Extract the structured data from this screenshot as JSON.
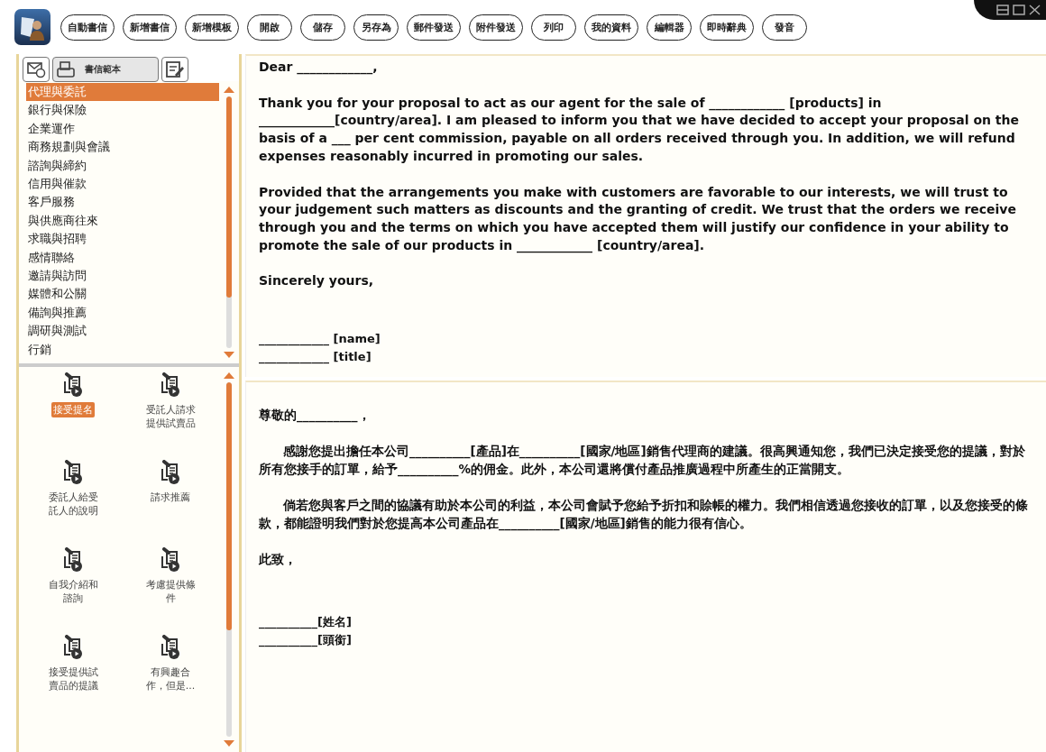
{
  "toolbar": {
    "buttons": [
      "自動書信",
      "新增書信",
      "新增模板",
      "開啟",
      "儲存",
      "另存為",
      "郵件發送",
      "附件發送",
      "列印",
      "我的資料",
      "編輯器",
      "即時辭典",
      "發音"
    ]
  },
  "side_tabs": [
    {
      "kind": "icon",
      "selected": false
    },
    {
      "kind": "labeled",
      "label": "書信範本",
      "selected": true
    },
    {
      "kind": "icon",
      "selected": false
    }
  ],
  "categories": [
    {
      "label": "代理與委託",
      "selected": true
    },
    {
      "label": "銀行與保險",
      "selected": false
    },
    {
      "label": "企業運作",
      "selected": false
    },
    {
      "label": "商務規劃與會議",
      "selected": false
    },
    {
      "label": "諮詢與締約",
      "selected": false
    },
    {
      "label": "信用與催款",
      "selected": false
    },
    {
      "label": "客戶服務",
      "selected": false
    },
    {
      "label": "與供應商往來",
      "selected": false
    },
    {
      "label": "求職與招聘",
      "selected": false
    },
    {
      "label": "感情聯絡",
      "selected": false
    },
    {
      "label": "邀請與訪問",
      "selected": false
    },
    {
      "label": "媒體和公關",
      "selected": false
    },
    {
      "label": "備詢與推薦",
      "selected": false
    },
    {
      "label": "調研與測試",
      "selected": false
    },
    {
      "label": "行銷",
      "selected": false
    }
  ],
  "templates": [
    {
      "label": "接受提名",
      "selected": true
    },
    {
      "label": "受託人請求提供試賣品",
      "selected": false
    },
    {
      "label": "委託人給受託人的說明",
      "selected": false
    },
    {
      "label": "請求推薦",
      "selected": false
    },
    {
      "label": "自我介紹和諮詢",
      "selected": false
    },
    {
      "label": "考慮提供條件",
      "selected": false
    },
    {
      "label": "接受提供試賣品的提議",
      "selected": false
    },
    {
      "label": "有興趣合作，但是...",
      "selected": false
    }
  ],
  "english_letter": {
    "paragraphs": [
      "Dear ____________,",
      "Thank you for your proposal to act as our agent for the sale of ____________ [products] in ____________[country/area]. I am pleased to inform you that we have decided to accept your proposal on the basis of a ___ per cent commission, payable on all orders received through you. In addition, we will refund expenses reasonably incurred in promoting our sales.",
      "Provided that the arrangements you make with customers are favorable to our interests, we will trust to your judgement such matters as discounts and the granting of credit. We trust that the orders we receive through you and the terms on which you have accepted them will justify our confidence in your ability to promote the sale of our products in ____________ [country/area].",
      "Sincerely yours,"
    ],
    "signature": [
      "____________ [name]",
      "____________ [title]"
    ]
  },
  "chinese_letter": {
    "paragraphs": [
      "尊敬的__________，",
      "感謝您提出擔任本公司__________[產品]在__________[國家/地區]銷售代理商的建議。很高興通知您，我們已決定接受您的提議，對於所有您接手的訂單，給予__________%的佣金。此外，本公司還將償付產品推廣過程中所產生的正當開支。",
      "倘若您與客戶之間的協議有助於本公司的利益，本公司會賦予您給予折扣和賒帳的權力。我們相信透過您接收的訂單，以及您接受的條款，都能證明我們對於您提高本公司產品在__________[國家/地區]銷售的能力很有信心。",
      "此致，"
    ],
    "signature": [
      "__________[姓名]",
      "__________[頭銜]"
    ]
  }
}
